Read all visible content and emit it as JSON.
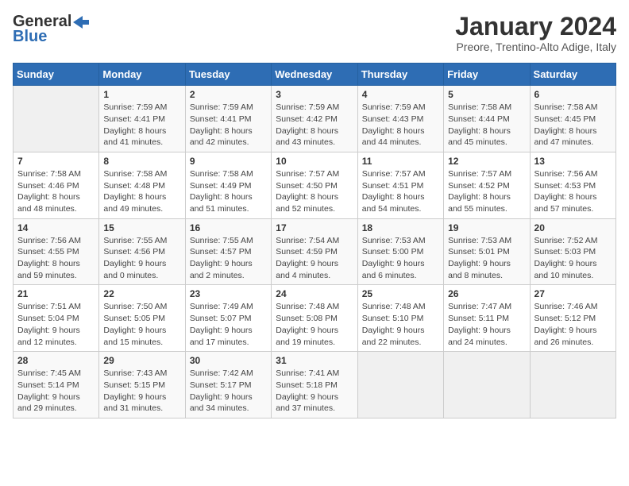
{
  "logo": {
    "general": "General",
    "blue": "Blue"
  },
  "title": "January 2024",
  "subtitle": "Preore, Trentino-Alto Adige, Italy",
  "days_of_week": [
    "Sunday",
    "Monday",
    "Tuesday",
    "Wednesday",
    "Thursday",
    "Friday",
    "Saturday"
  ],
  "weeks": [
    [
      {
        "day": "",
        "info": ""
      },
      {
        "day": "1",
        "info": "Sunrise: 7:59 AM\nSunset: 4:41 PM\nDaylight: 8 hours\nand 41 minutes."
      },
      {
        "day": "2",
        "info": "Sunrise: 7:59 AM\nSunset: 4:41 PM\nDaylight: 8 hours\nand 42 minutes."
      },
      {
        "day": "3",
        "info": "Sunrise: 7:59 AM\nSunset: 4:42 PM\nDaylight: 8 hours\nand 43 minutes."
      },
      {
        "day": "4",
        "info": "Sunrise: 7:59 AM\nSunset: 4:43 PM\nDaylight: 8 hours\nand 44 minutes."
      },
      {
        "day": "5",
        "info": "Sunrise: 7:58 AM\nSunset: 4:44 PM\nDaylight: 8 hours\nand 45 minutes."
      },
      {
        "day": "6",
        "info": "Sunrise: 7:58 AM\nSunset: 4:45 PM\nDaylight: 8 hours\nand 47 minutes."
      }
    ],
    [
      {
        "day": "7",
        "info": "Sunrise: 7:58 AM\nSunset: 4:46 PM\nDaylight: 8 hours\nand 48 minutes."
      },
      {
        "day": "8",
        "info": "Sunrise: 7:58 AM\nSunset: 4:48 PM\nDaylight: 8 hours\nand 49 minutes."
      },
      {
        "day": "9",
        "info": "Sunrise: 7:58 AM\nSunset: 4:49 PM\nDaylight: 8 hours\nand 51 minutes."
      },
      {
        "day": "10",
        "info": "Sunrise: 7:57 AM\nSunset: 4:50 PM\nDaylight: 8 hours\nand 52 minutes."
      },
      {
        "day": "11",
        "info": "Sunrise: 7:57 AM\nSunset: 4:51 PM\nDaylight: 8 hours\nand 54 minutes."
      },
      {
        "day": "12",
        "info": "Sunrise: 7:57 AM\nSunset: 4:52 PM\nDaylight: 8 hours\nand 55 minutes."
      },
      {
        "day": "13",
        "info": "Sunrise: 7:56 AM\nSunset: 4:53 PM\nDaylight: 8 hours\nand 57 minutes."
      }
    ],
    [
      {
        "day": "14",
        "info": "Sunrise: 7:56 AM\nSunset: 4:55 PM\nDaylight: 8 hours\nand 59 minutes."
      },
      {
        "day": "15",
        "info": "Sunrise: 7:55 AM\nSunset: 4:56 PM\nDaylight: 9 hours\nand 0 minutes."
      },
      {
        "day": "16",
        "info": "Sunrise: 7:55 AM\nSunset: 4:57 PM\nDaylight: 9 hours\nand 2 minutes."
      },
      {
        "day": "17",
        "info": "Sunrise: 7:54 AM\nSunset: 4:59 PM\nDaylight: 9 hours\nand 4 minutes."
      },
      {
        "day": "18",
        "info": "Sunrise: 7:53 AM\nSunset: 5:00 PM\nDaylight: 9 hours\nand 6 minutes."
      },
      {
        "day": "19",
        "info": "Sunrise: 7:53 AM\nSunset: 5:01 PM\nDaylight: 9 hours\nand 8 minutes."
      },
      {
        "day": "20",
        "info": "Sunrise: 7:52 AM\nSunset: 5:03 PM\nDaylight: 9 hours\nand 10 minutes."
      }
    ],
    [
      {
        "day": "21",
        "info": "Sunrise: 7:51 AM\nSunset: 5:04 PM\nDaylight: 9 hours\nand 12 minutes."
      },
      {
        "day": "22",
        "info": "Sunrise: 7:50 AM\nSunset: 5:05 PM\nDaylight: 9 hours\nand 15 minutes."
      },
      {
        "day": "23",
        "info": "Sunrise: 7:49 AM\nSunset: 5:07 PM\nDaylight: 9 hours\nand 17 minutes."
      },
      {
        "day": "24",
        "info": "Sunrise: 7:48 AM\nSunset: 5:08 PM\nDaylight: 9 hours\nand 19 minutes."
      },
      {
        "day": "25",
        "info": "Sunrise: 7:48 AM\nSunset: 5:10 PM\nDaylight: 9 hours\nand 22 minutes."
      },
      {
        "day": "26",
        "info": "Sunrise: 7:47 AM\nSunset: 5:11 PM\nDaylight: 9 hours\nand 24 minutes."
      },
      {
        "day": "27",
        "info": "Sunrise: 7:46 AM\nSunset: 5:12 PM\nDaylight: 9 hours\nand 26 minutes."
      }
    ],
    [
      {
        "day": "28",
        "info": "Sunrise: 7:45 AM\nSunset: 5:14 PM\nDaylight: 9 hours\nand 29 minutes."
      },
      {
        "day": "29",
        "info": "Sunrise: 7:43 AM\nSunset: 5:15 PM\nDaylight: 9 hours\nand 31 minutes."
      },
      {
        "day": "30",
        "info": "Sunrise: 7:42 AM\nSunset: 5:17 PM\nDaylight: 9 hours\nand 34 minutes."
      },
      {
        "day": "31",
        "info": "Sunrise: 7:41 AM\nSunset: 5:18 PM\nDaylight: 9 hours\nand 37 minutes."
      },
      {
        "day": "",
        "info": ""
      },
      {
        "day": "",
        "info": ""
      },
      {
        "day": "",
        "info": ""
      }
    ]
  ]
}
